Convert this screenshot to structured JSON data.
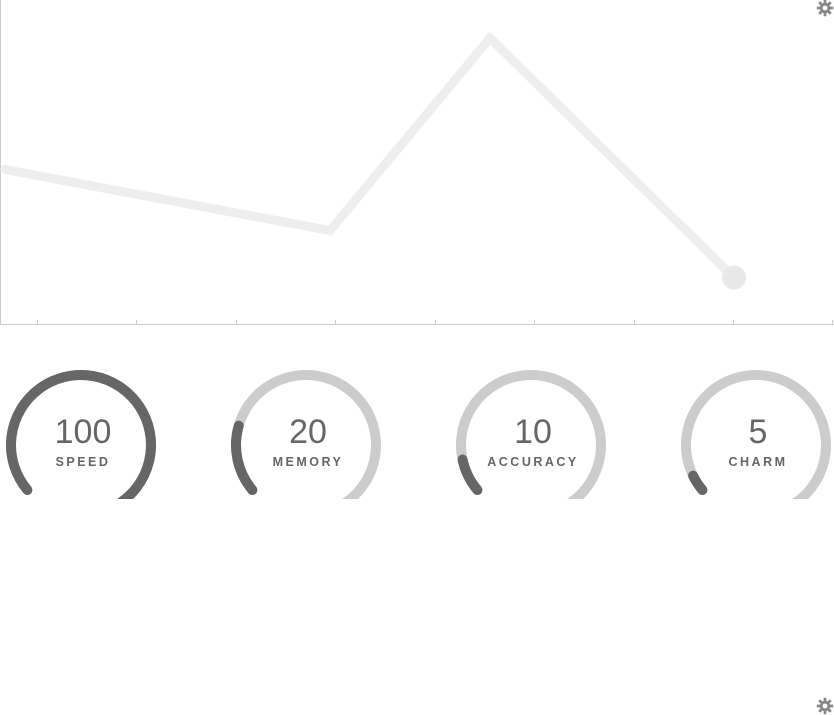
{
  "chart_data": {
    "type": "line",
    "series": [
      {
        "values": [
          56,
          30,
          112,
          10
        ]
      }
    ],
    "ylim": [
      0,
      112
    ],
    "grid": false,
    "colors": {
      "line": "#eeeeee",
      "axis": "#cccccc",
      "end_marker": "#e8e8e8"
    }
  },
  "gauges": [
    {
      "value": "100",
      "label": "SPEED",
      "level": 100,
      "max": 100
    },
    {
      "value": "20",
      "label": "MEMORY",
      "level": 20,
      "max": 100
    },
    {
      "value": "10",
      "label": "ACCURACY",
      "level": 10,
      "max": 100
    },
    {
      "value": "5",
      "label": "CHARM",
      "level": 5,
      "max": 100
    }
  ],
  "colors": {
    "gauge_track": "#cccccc",
    "gauge_fill": "#666666",
    "settings_icon": "#888888"
  },
  "icons": {
    "chart_settings": "gear-icon",
    "gauges_settings": "gear-icon"
  }
}
